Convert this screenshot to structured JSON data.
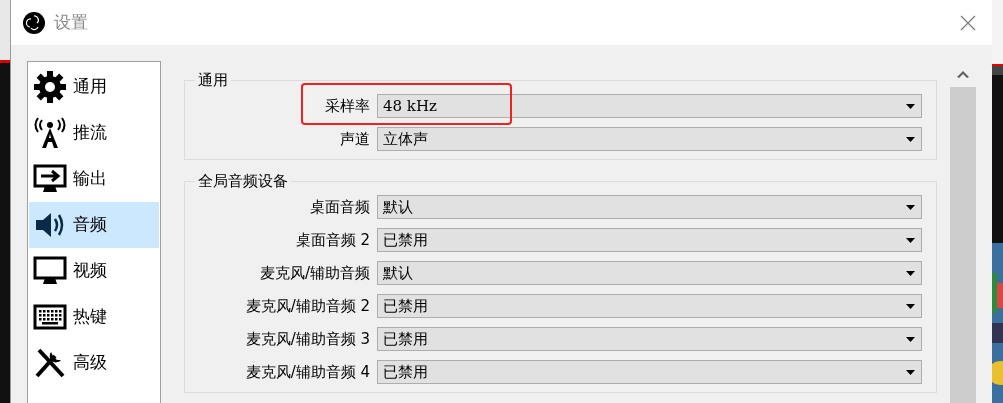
{
  "window": {
    "title": "设置"
  },
  "sidebar": {
    "items": [
      {
        "label": "通用",
        "selected": false
      },
      {
        "label": "推流",
        "selected": false
      },
      {
        "label": "输出",
        "selected": false
      },
      {
        "label": "音频",
        "selected": true
      },
      {
        "label": "视频",
        "selected": false
      },
      {
        "label": "热键",
        "selected": false
      },
      {
        "label": "高级",
        "selected": false
      }
    ]
  },
  "groups": [
    {
      "title": "通用",
      "rows": [
        {
          "label": "采样率",
          "value": "48 kHz",
          "highlighted": true
        },
        {
          "label": "声道",
          "value": "立体声",
          "highlighted": false
        }
      ]
    },
    {
      "title": "全局音频设备",
      "rows": [
        {
          "label": "桌面音频",
          "value": "默认",
          "highlighted": false
        },
        {
          "label": "桌面音频 2",
          "value": "已禁用",
          "highlighted": false
        },
        {
          "label": "麦克风/辅助音频",
          "value": "默认",
          "highlighted": false
        },
        {
          "label": "麦克风/辅助音频 2",
          "value": "已禁用",
          "highlighted": false
        },
        {
          "label": "麦克风/辅助音频 3",
          "value": "已禁用",
          "highlighted": false
        },
        {
          "label": "麦克风/辅助音频 4",
          "value": "已禁用",
          "highlighted": false
        }
      ]
    }
  ]
}
